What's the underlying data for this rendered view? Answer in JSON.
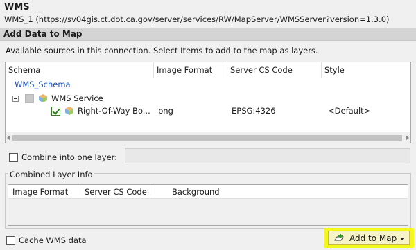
{
  "header": {
    "title": "WMS",
    "connection": "WMS_1 (https://sv04gis.ct.dot.ca.gov/server/services/RW/MapServer/WMSServer?version=1.3.0)"
  },
  "section": {
    "title": "Add Data to Map",
    "instructions": "Available sources in this connection.  Select Items to add to the map as layers."
  },
  "tree": {
    "columns": [
      "Schema",
      "Image Format",
      "Server CS Code",
      "Style"
    ],
    "schema_node": "WMS_Schema",
    "service_node": "WMS Service",
    "layer": {
      "name": "Right-Of-Way Bo...",
      "image_format": "png",
      "server_cs_code": "EPSG:4326",
      "style": "<Default>",
      "checked": true
    }
  },
  "combine": {
    "label": "Combine into one layer:",
    "checked": false,
    "value": ""
  },
  "combined_info": {
    "legend": "Combined Layer Info",
    "columns": [
      "Image Format",
      "Server CS Code",
      "Background"
    ]
  },
  "footer": {
    "cache_label": "Cache WMS data",
    "cache_checked": false,
    "add_button": "Add to Map",
    "add_button_highlight": "#f4f81a"
  }
}
